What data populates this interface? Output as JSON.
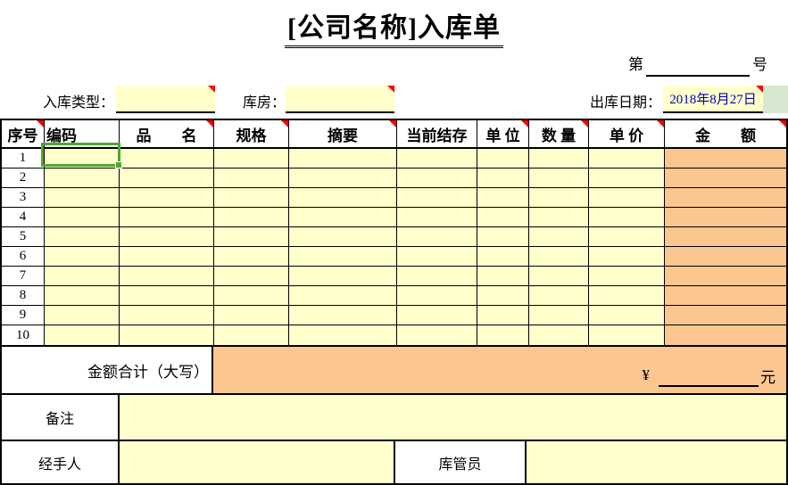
{
  "title": "[公司名称]入库单",
  "doc_number": {
    "prefix": "第",
    "suffix": "号"
  },
  "fields": {
    "entry_type_label": "入库类型：",
    "entry_type_value": "",
    "warehouse_label": "库房：",
    "warehouse_value": "",
    "date_label": "出库日期：",
    "date_value": "2018年8月27日"
  },
  "table": {
    "headers": [
      "序号",
      "编码",
      "品　　名",
      "规格",
      "摘要",
      "当前结存",
      "单 位",
      "数 量",
      "单 价",
      "金　　额"
    ],
    "row_numbers": [
      "1",
      "2",
      "3",
      "4",
      "5",
      "6",
      "7",
      "8",
      "9",
      "10"
    ]
  },
  "total": {
    "label": "金额合计（大写）",
    "currency_symbol": "¥",
    "unit": "元"
  },
  "footer": {
    "remarks_label": "备注",
    "handler_label": "经手人",
    "keeper_label": "库管员"
  },
  "colors": {
    "cell_yellow": "#FFFFCC",
    "amount_orange": "#FBC690",
    "selection_green": "#4EA72E",
    "date_cell_green": "#D8E7CF",
    "date_text_blue": "#0000B8",
    "comment_red": "#FF0000"
  }
}
